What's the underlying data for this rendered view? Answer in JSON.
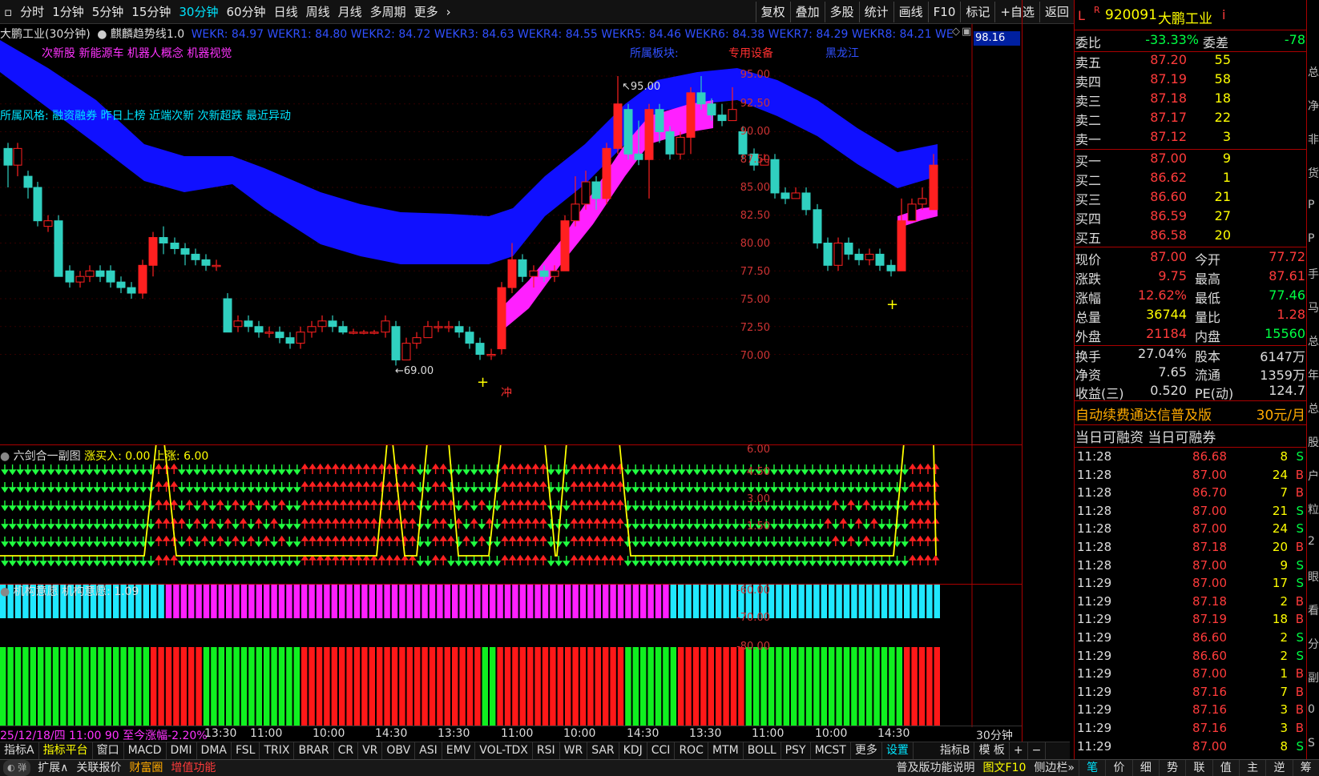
{
  "toolbar": {
    "periods": [
      "分时",
      "1分钟",
      "5分钟",
      "15分钟",
      "30分钟",
      "60分钟",
      "日线",
      "周线",
      "月线",
      "多周期",
      "更多"
    ],
    "active": "30分钟",
    "right": [
      "复权",
      "叠加",
      "多股",
      "统计",
      "画线",
      "F10",
      "标记",
      "+自选",
      "返回"
    ]
  },
  "main": {
    "title": "大鹏工业(30分钟)",
    "indicator": "麒麟趋势线1.0",
    "wekr": "WEKR: 84.97 WEKR1: 84.80 WEKR2: 84.72 WEKR3: 84.63 WEKR4: 84.55 WEKR5: 84.46 WEKR6: 84.38 WEKR7: 84.29 WEKR8: 84.21 WEKR",
    "price_tag": "98.16",
    "concepts": "次新股 新能源车 机器人概念 机器视觉",
    "style": "所属风格: 融资融券 昨日上榜 近端次新 次新超跌 最近异动",
    "sector_label": "所属板块:",
    "sector": "专用设备",
    "region": "黑龙江",
    "high_mark": "95.00",
    "low_mark": "69.00",
    "signal": "冲",
    "yticks": [
      "95.00",
      "92.50",
      "90.00",
      "87.50",
      "85.00",
      "82.50",
      "80.00",
      "77.50",
      "75.00",
      "72.50",
      "70.00"
    ]
  },
  "ind1": {
    "title": "六剑合一副图",
    "l1": "涨买入: 0.00",
    "l2": "上涨: 6.00",
    "yticks": [
      "6.00",
      "4.50",
      "3.00",
      "1.50"
    ]
  },
  "ind2": {
    "title": "机构意愿",
    "val": "机构意愿: 1.09",
    "yticks": [
      "-60.00",
      "-70.00",
      "-80.00"
    ]
  },
  "xaxis": {
    "info": "25/12/18/四 11:00 90 至今涨幅-2.20%",
    "labels": [
      "13:30",
      "11:00",
      "10:00",
      "14:30",
      "13:30",
      "11:00",
      "10:00",
      "14:30",
      "13:30",
      "11:00",
      "10:00",
      "14:30"
    ],
    "period": "30分钟"
  },
  "tabs": [
    "指标A",
    "指标平台",
    "窗口",
    "MACD",
    "DMI",
    "DMA",
    "FSL",
    "TRIX",
    "BRAR",
    "CR",
    "VR",
    "OBV",
    "ASI",
    "EMV",
    "VOL-TDX",
    "RSI",
    "WR",
    "SAR",
    "KDJ",
    "CCI",
    "ROC",
    "MTM",
    "BOLL",
    "PSY",
    "MCST",
    "更多",
    "设置",
    "指标B",
    "模 板",
    "+",
    "−"
  ],
  "bottom": {
    "left": [
      "扩展∧",
      "关联报价",
      "财富圈",
      "增值功能"
    ],
    "right": [
      "普及版功能说明",
      "图文F10",
      "侧边栏»"
    ],
    "panel_tabs": [
      "笔",
      "价",
      "细",
      "势",
      "联",
      "值",
      "主",
      "逆",
      "筹"
    ]
  },
  "rp": {
    "prefix": "L",
    "badge": "R",
    "code": "920091",
    "name": "大鹏工业",
    "suffix": "i",
    "wb_l": "委比",
    "wb": "-33.33%",
    "wc_l": "委差",
    "wc": "-78",
    "asks": [
      {
        "l": "卖五",
        "p": "87.20",
        "v": "55"
      },
      {
        "l": "卖四",
        "p": "87.19",
        "v": "58"
      },
      {
        "l": "卖三",
        "p": "87.18",
        "v": "18"
      },
      {
        "l": "卖二",
        "p": "87.17",
        "v": "22"
      },
      {
        "l": "卖一",
        "p": "87.12",
        "v": "3"
      }
    ],
    "bids": [
      {
        "l": "买一",
        "p": "87.00",
        "v": "9"
      },
      {
        "l": "买二",
        "p": "86.62",
        "v": "1"
      },
      {
        "l": "买三",
        "p": "86.60",
        "v": "21"
      },
      {
        "l": "买四",
        "p": "86.59",
        "v": "27"
      },
      {
        "l": "买五",
        "p": "86.58",
        "v": "20"
      }
    ],
    "stats": [
      {
        "a": "现价",
        "b": "87.00",
        "c": "今开",
        "d": "77.72"
      },
      {
        "a": "涨跌",
        "b": "9.75",
        "c": "最高",
        "d": "87.61"
      },
      {
        "a": "涨幅",
        "b": "12.62%",
        "c": "最低",
        "d": "77.46"
      },
      {
        "a": "总量",
        "b": "36744",
        "c": "量比",
        "d": "1.28"
      },
      {
        "a": "外盘",
        "b": "21184",
        "c": "内盘",
        "d": "15560"
      }
    ],
    "stats2": [
      {
        "a": "换手",
        "b": "27.04%",
        "c": "股本",
        "d": "6147万"
      },
      {
        "a": "净资",
        "b": "7.65",
        "c": "流通",
        "d": "1359万"
      },
      {
        "a": "收益(三)",
        "b": "0.520",
        "c": "PE(动)",
        "d": "124.7"
      }
    ],
    "ad": "自动续费通达信普及版",
    "ad_price": "30元/月",
    "margin": "当日可融资 当日可融券",
    "ticks": [
      {
        "t": "11:28",
        "p": "86.68",
        "q": "8",
        "d": "S"
      },
      {
        "t": "11:28",
        "p": "87.00",
        "q": "24",
        "d": "B"
      },
      {
        "t": "11:28",
        "p": "86.70",
        "q": "7",
        "d": "B"
      },
      {
        "t": "11:28",
        "p": "87.00",
        "q": "21",
        "d": "S"
      },
      {
        "t": "11:28",
        "p": "87.00",
        "q": "24",
        "d": "S"
      },
      {
        "t": "11:28",
        "p": "87.18",
        "q": "20",
        "d": "B"
      },
      {
        "t": "11:28",
        "p": "87.00",
        "q": "9",
        "d": "S"
      },
      {
        "t": "11:29",
        "p": "87.00",
        "q": "17",
        "d": "S"
      },
      {
        "t": "11:29",
        "p": "87.18",
        "q": "2",
        "d": "B"
      },
      {
        "t": "11:29",
        "p": "87.19",
        "q": "18",
        "d": "B"
      },
      {
        "t": "11:29",
        "p": "86.60",
        "q": "2",
        "d": "S"
      },
      {
        "t": "11:29",
        "p": "86.60",
        "q": "2",
        "d": "S"
      },
      {
        "t": "11:29",
        "p": "87.00",
        "q": "1",
        "d": "B"
      },
      {
        "t": "11:29",
        "p": "87.16",
        "q": "7",
        "d": "B"
      },
      {
        "t": "11:29",
        "p": "87.16",
        "q": "3",
        "d": "B"
      },
      {
        "t": "11:29",
        "p": "87.16",
        "q": "3",
        "d": "B"
      },
      {
        "t": "11:29",
        "p": "87.00",
        "q": "8",
        "d": "S"
      }
    ]
  },
  "edge": [
    "总",
    "净",
    "非",
    "货",
    "P",
    "P",
    "手",
    "马",
    "总",
    "年",
    "总",
    "股",
    "户",
    "粒",
    "2",
    "眼",
    "看",
    "分",
    "副",
    "0",
    "S"
  ]
}
